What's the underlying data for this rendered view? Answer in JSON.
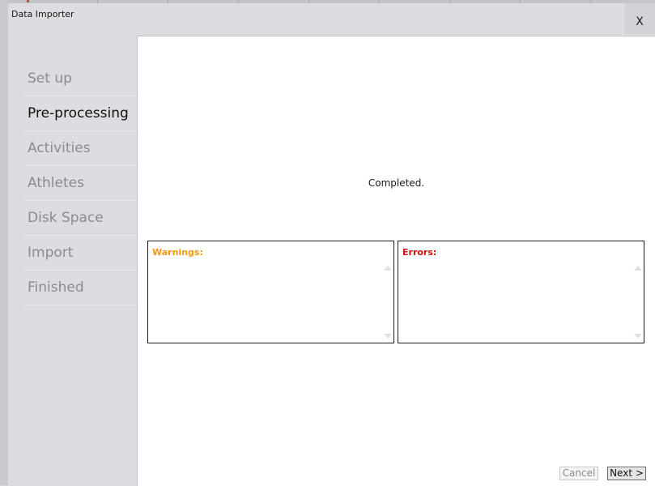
{
  "window": {
    "title": "Data Importer",
    "close_label": "X"
  },
  "steps": [
    {
      "label": "Set up",
      "active": false
    },
    {
      "label": "Pre-processing",
      "active": true
    },
    {
      "label": "Activities",
      "active": false
    },
    {
      "label": "Athletes",
      "active": false
    },
    {
      "label": "Disk Space",
      "active": false
    },
    {
      "label": "Import",
      "active": false
    },
    {
      "label": "Finished",
      "active": false
    }
  ],
  "main": {
    "status_text": "Completed.",
    "warnings_label": "Warnings:",
    "errors_label": "Errors:"
  },
  "buttons": {
    "cancel_label": "Cancel",
    "next_label": "Next >"
  },
  "colors": {
    "warnings": "#f39a12",
    "errors": "#d10f0f",
    "active_step": "#111111",
    "inactive_step": "#8a8b8f"
  }
}
